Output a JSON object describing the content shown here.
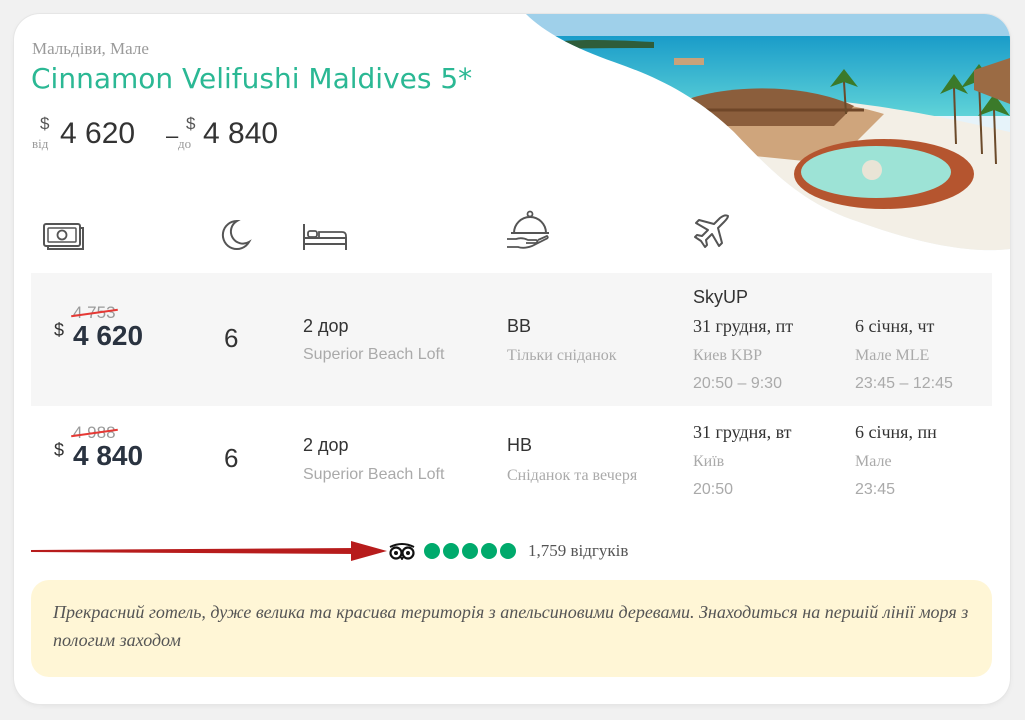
{
  "hotel": {
    "location": "Мальдіви, Мале",
    "name": "Cinnamon Velifushi Maldives 5*",
    "price_from_currency": "$",
    "price_from_label": "від",
    "price_from": "4 620",
    "price_sep": "–",
    "price_to_currency": "$",
    "price_to_label": "до",
    "price_to": "4 840"
  },
  "columns": {
    "icons": [
      "money-icon",
      "moon-icon",
      "bed-icon",
      "food-service-icon",
      "airplane-icon"
    ]
  },
  "offers": [
    {
      "currency": "$",
      "old_price": "4 753",
      "price": "4 620",
      "nights": "6",
      "guests": "2 дор",
      "room": "Superior Beach Loft",
      "meal_code": "BB",
      "meal_desc": "Тільки сніданок",
      "airline": "SkyUP",
      "depart_date": "31 грудня, пт",
      "depart_airport": "Киев KBP",
      "depart_time": "20:50 – 9:30",
      "return_date": "6 січня, чт",
      "return_airport": "Мале MLE",
      "return_time": "23:45 – 12:45"
    },
    {
      "currency": "$",
      "old_price": "4 988",
      "price": "4 840",
      "nights": "6",
      "guests": "2 дор",
      "room": "Superior Beach Loft",
      "meal_code": "HB",
      "meal_desc": "Сніданок та вечеря",
      "depart_date": "31 грудня, вт",
      "depart_airport": "Київ",
      "depart_time": "20:50",
      "return_date": "6 січня, пн",
      "return_airport": "Мале",
      "return_time": "23:45"
    }
  ],
  "rating": {
    "provider_icon": "tripadvisor-owl-icon",
    "score": 5,
    "max": 5,
    "reviews": "1,759 відгуків"
  },
  "description": "Прекрасний готель, дуже велика та красива територія з апельсиновими деревами. Знаходиться на першій лінії моря з пологим заходом",
  "colors": {
    "accent": "#2bb894",
    "rating": "#00aa6c",
    "arrow": "#b71c1c",
    "note_bg": "#fff6d6",
    "strike": "#e53935"
  }
}
